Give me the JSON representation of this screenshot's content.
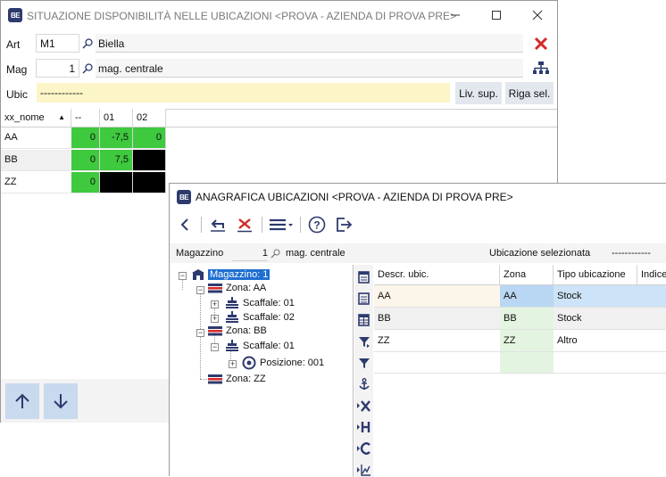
{
  "win1": {
    "title": "SITUAZIONE DISPONIBILITÀ NELLE UBICAZIONI <PROVA - AZIENDA DI PROVA PRE>",
    "app_icon": "BE",
    "art_label": "Art",
    "art_value": "M1",
    "art_desc": "Biella",
    "mag_label": "Mag",
    "mag_value": "1",
    "mag_desc": "mag. centrale",
    "ubic_label": "Ubic",
    "ubic_value": "------------",
    "liv_sup_label": "Liv. sup.",
    "riga_sel_label": "Riga sel.",
    "grid": {
      "headers": [
        "xx_nome",
        "--",
        "01",
        "02"
      ],
      "rows": [
        {
          "name": "AA",
          "c0": "0",
          "c1": "-7,5",
          "c2": "0"
        },
        {
          "name": "BB",
          "c0": "0",
          "c1": "7,5",
          "c2": ""
        },
        {
          "name": "ZZ",
          "c0": "0",
          "c1": "",
          "c2": ""
        }
      ]
    }
  },
  "win2": {
    "title": "ANAGRAFICA UBICAZIONI <PROVA - AZIENDA DI PROVA PRE>",
    "app_icon": "BE",
    "filter": {
      "magazzino_label": "Magazzino",
      "magazzino_value": "1",
      "magazzino_desc": "mag. centrale",
      "ubic_sel_label": "Ubicazione selezionata",
      "ubic_sel_value": "------------"
    },
    "tree": {
      "root": "Magazzino: 1",
      "zona_aa": "Zona: AA",
      "scaffale_aa_01": "Scaffale: 01",
      "scaffale_aa_02": "Scaffale: 02",
      "zona_bb": "Zona: BB",
      "scaffale_bb_01": "Scaffale: 01",
      "posizione_001": "Posizione: 001",
      "zona_zz": "Zona: ZZ"
    },
    "grid": {
      "headers": [
        "Descr. ubic.",
        "Zona",
        "Tipo ubicazione",
        "Indice"
      ],
      "rows": [
        {
          "descr": "AA",
          "zona": "AA",
          "tipo": "Stock"
        },
        {
          "descr": "BB",
          "zona": "BB",
          "tipo": "Stock"
        },
        {
          "descr": "ZZ",
          "zona": "ZZ",
          "tipo": "Altro"
        }
      ]
    }
  },
  "colors": {
    "green": "#3ec93e",
    "selected_row": "#cde3f7",
    "zona_column": "#e3f5e0",
    "ubic_field": "#fbf5c8",
    "accent_red": "#d62828",
    "icon_blue": "#2d3a6e"
  }
}
